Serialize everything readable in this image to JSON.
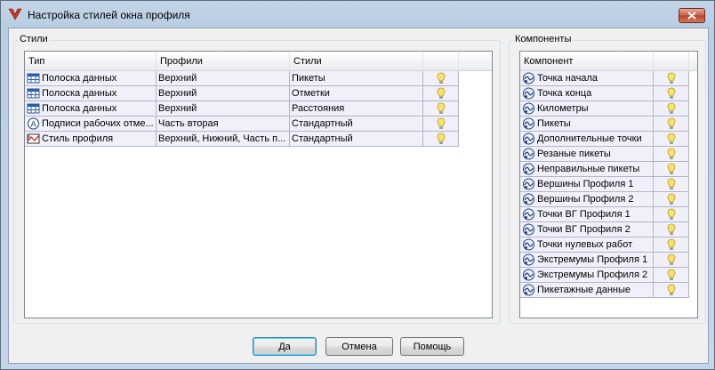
{
  "window": {
    "title": "Настройка стилей окна профиля"
  },
  "styles_group": {
    "legend": "Стили",
    "columns": [
      "Тип",
      "Профили",
      "Стили"
    ],
    "rows": [
      {
        "icon": "data-band-icon",
        "type": "Полоска данных",
        "profiles": "Верхний",
        "style": "Пикеты"
      },
      {
        "icon": "data-band-icon",
        "type": "Полоска данных",
        "profiles": "Верхний",
        "style": "Отметки"
      },
      {
        "icon": "data-band-icon",
        "type": "Полоска данных",
        "profiles": "Верхний",
        "style": "Расстояния"
      },
      {
        "icon": "label-icon",
        "type": "Подписи рабочих отме...",
        "profiles": "Часть вторая",
        "style": "Стандартный"
      },
      {
        "icon": "profile-style-icon",
        "type": "Стиль профиля",
        "profiles": "Верхний, Нижний, Часть п...",
        "style": "Стандартный"
      }
    ]
  },
  "components_group": {
    "legend": "Компоненты",
    "column": "Компонент",
    "rows": [
      "Точка начала",
      "Точка конца",
      "Километры",
      "Пикеты",
      "Дополнительные точки",
      "Резаные пикеты",
      "Неправильные пикеты",
      "Вершины Профиля 1",
      "Вершины Профиля 2",
      "Точки ВГ Профиля 1",
      "Точки ВГ Профиля 2",
      "Точки нулевых работ",
      "Экстремумы Профиля 1",
      "Экстремумы Профиля 2",
      "Пикетажные данные"
    ]
  },
  "buttons": {
    "ok": "Да",
    "cancel": "Отмена",
    "help": "Помощь"
  },
  "colors": {
    "row_bg": "#f0f0fa",
    "row_border": "#b4b4c8",
    "bulb": "#f7e36a",
    "default_button": "#3c7fb1"
  }
}
